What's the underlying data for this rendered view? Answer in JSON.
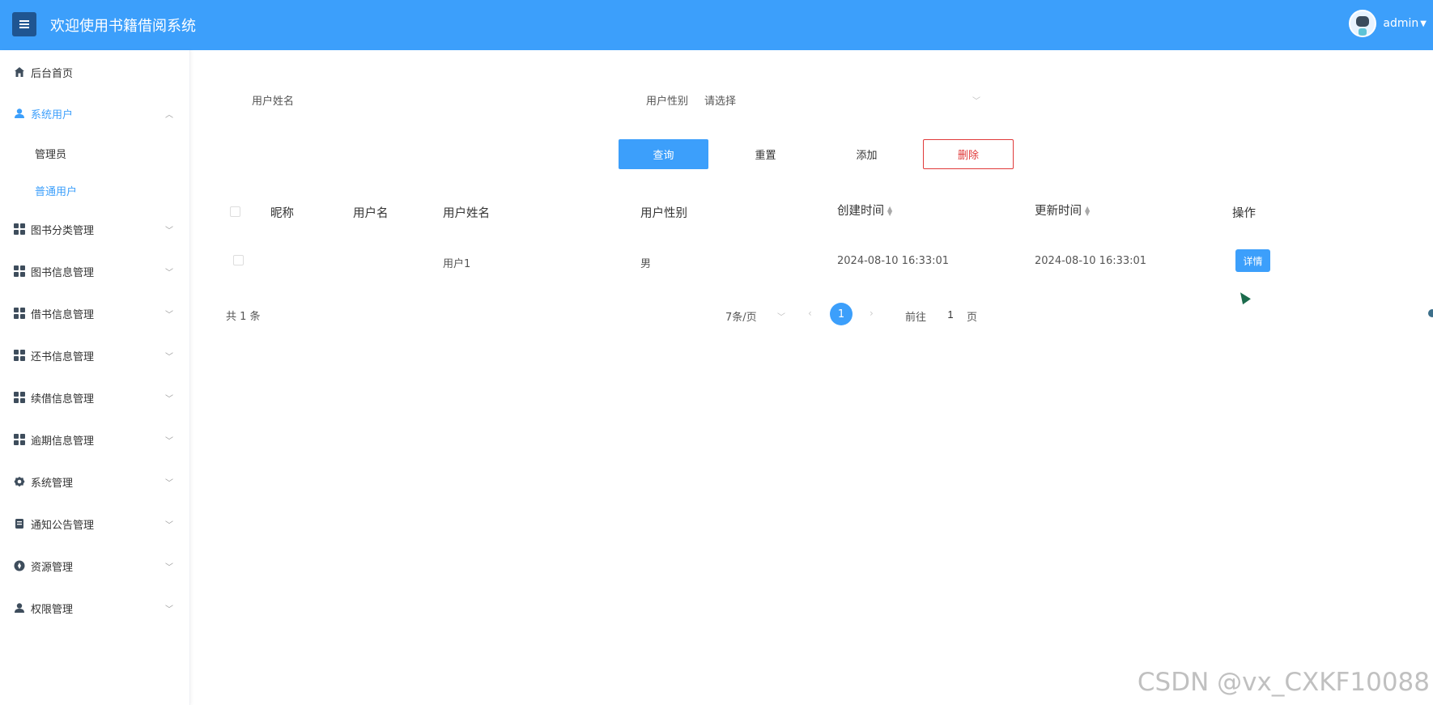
{
  "app": {
    "title": "欢迎使用书籍借阅系统",
    "user": "admin",
    "accent": "#3c9ffb",
    "icons": {
      "menu": "hamburger-icon",
      "avatar": "robot-avatar",
      "caret": "chevron-down-icon"
    }
  },
  "sidebar": {
    "items": [
      {
        "label": "后台首页",
        "icon": "home-icon"
      },
      {
        "label": "系统用户",
        "icon": "user-icon",
        "expanded": true,
        "children": [
          {
            "label": "管理员"
          },
          {
            "label": "普通用户",
            "active": true
          }
        ]
      },
      {
        "label": "图书分类管理",
        "icon": "grid-icon"
      },
      {
        "label": "图书信息管理",
        "icon": "grid-icon"
      },
      {
        "label": "借书信息管理",
        "icon": "grid-icon"
      },
      {
        "label": "还书信息管理",
        "icon": "grid-icon"
      },
      {
        "label": "续借信息管理",
        "icon": "grid-icon"
      },
      {
        "label": "逾期信息管理",
        "icon": "grid-icon"
      },
      {
        "label": "系统管理",
        "icon": "gear-icon"
      },
      {
        "label": "通知公告管理",
        "icon": "document-icon"
      },
      {
        "label": "资源管理",
        "icon": "compass-icon"
      },
      {
        "label": "权限管理",
        "icon": "user-icon"
      }
    ]
  },
  "filters": {
    "name_label": "用户姓名",
    "name_value": "",
    "gender_label": "用户性别",
    "gender_placeholder": "请选择"
  },
  "actions": {
    "search": "查询",
    "reset": "重置",
    "add": "添加",
    "delete": "删除"
  },
  "table": {
    "columns": [
      "昵称",
      "用户名",
      "用户姓名",
      "用户性别",
      "创建时间",
      "更新时间",
      "操作"
    ],
    "rows": [
      {
        "nickname": "",
        "username": "",
        "realname": "用户1",
        "gender": "男",
        "created": "2024-08-10 16:33:01",
        "updated": "2024-08-10 16:33:01",
        "action": "详情"
      }
    ]
  },
  "pagination": {
    "total": "共 1 条",
    "page_size": "7条/页",
    "current": "1",
    "goto_prefix": "前往",
    "goto_value": "1",
    "goto_suffix": "页"
  },
  "watermark": "CSDN @vx_CXKF10088"
}
